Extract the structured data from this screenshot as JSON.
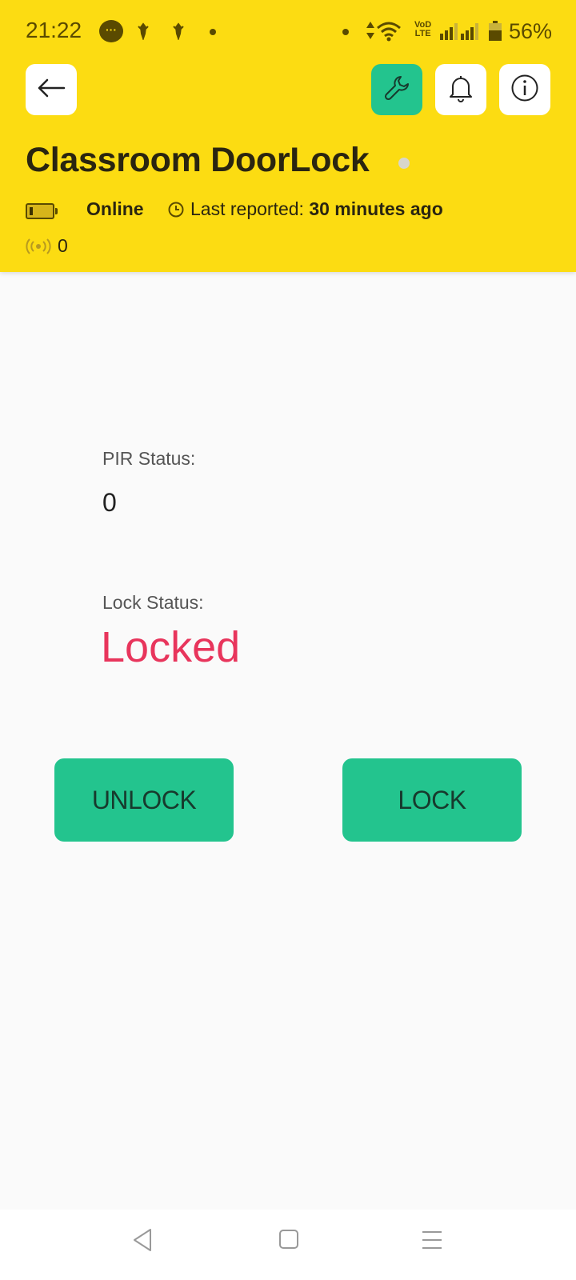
{
  "status_bar": {
    "time": "21:22",
    "volte_top": "VoD",
    "volte_bottom": "LTE",
    "battery_percent": "56%",
    "icons": [
      "message-icon",
      "notification-icon",
      "notification-icon",
      "dot-icon",
      "dot-icon",
      "data-arrows-icon",
      "wifi-icon",
      "volte-icon",
      "cell-signal-icon",
      "cell-signal-icon",
      "battery-icon"
    ]
  },
  "header": {
    "back_icon": "arrow-left-icon",
    "tools_icon": "wrench-icon",
    "notifications_icon": "bell-icon",
    "info_icon": "info-icon",
    "title": "Classroom DoorLock",
    "connection_status": "Online",
    "last_reported_label": "Last reported:",
    "last_reported_value": "30 minutes ago",
    "signal_count": "0",
    "accent_color": "#fcdc12",
    "tools_color": "#23c48e"
  },
  "content": {
    "pir_label": "PIR Status:",
    "pir_value": "0",
    "lock_label": "Lock Status:",
    "lock_value": "Locked",
    "lock_value_color": "#e8355c",
    "unlock_button": "UNLOCK",
    "lock_button": "LOCK",
    "button_color": "#23c48e"
  },
  "nav_bar": {
    "icons": [
      "back-nav-icon",
      "home-nav-icon",
      "menu-nav-icon"
    ]
  }
}
